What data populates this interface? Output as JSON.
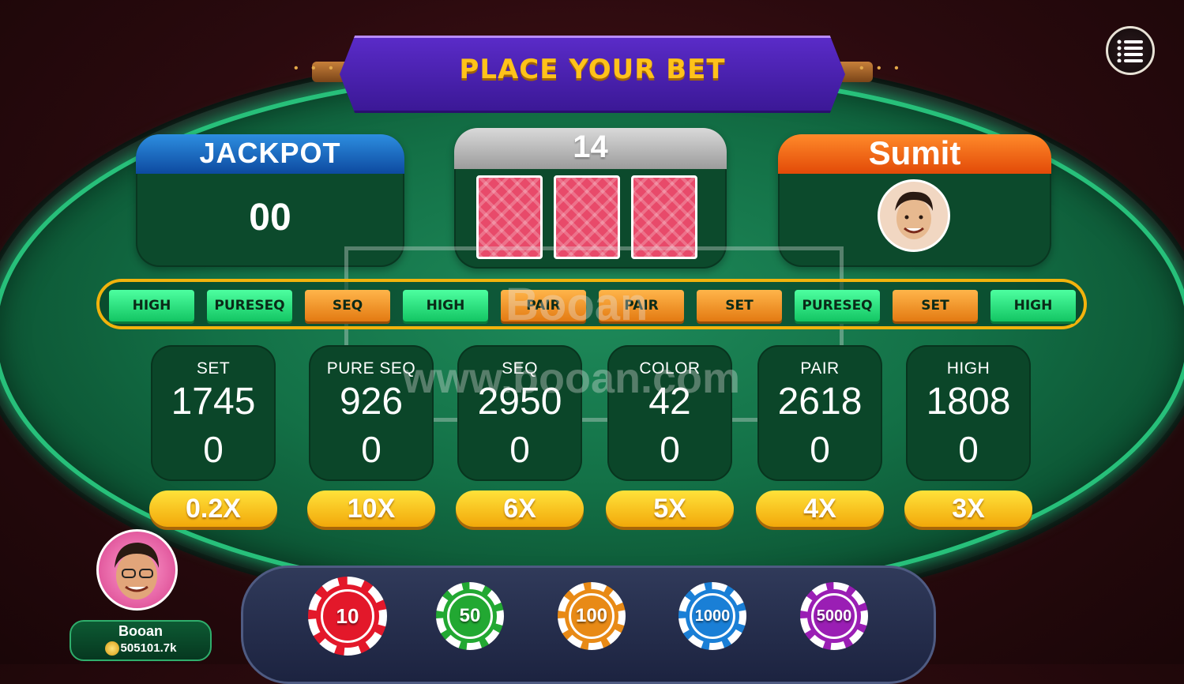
{
  "banner": {
    "title": "PLACE YOUR BET"
  },
  "menu": {
    "icon": "menu-icon"
  },
  "jackpot": {
    "label": "JACKPOT",
    "value": "00"
  },
  "round": {
    "timer": "14"
  },
  "player": {
    "name": "Sumit"
  },
  "history": [
    {
      "label": "HIGH",
      "color": "green"
    },
    {
      "label": "PURESEQ",
      "color": "green"
    },
    {
      "label": "SEQ",
      "color": "orange"
    },
    {
      "label": "HIGH",
      "color": "green"
    },
    {
      "label": "PAIR",
      "color": "orange"
    },
    {
      "label": "PAIR",
      "color": "orange"
    },
    {
      "label": "SET",
      "color": "orange"
    },
    {
      "label": "PURESEQ",
      "color": "green"
    },
    {
      "label": "SET",
      "color": "orange"
    },
    {
      "label": "HIGH",
      "color": "green"
    }
  ],
  "bets": [
    {
      "label": "SET",
      "total": "1745",
      "mine": "0",
      "multiplier": "0.2X"
    },
    {
      "label": "PURE SEQ",
      "total": "926",
      "mine": "0",
      "multiplier": "10X"
    },
    {
      "label": "SEQ",
      "total": "2950",
      "mine": "0",
      "multiplier": "6X"
    },
    {
      "label": "COLOR",
      "total": "42",
      "mine": "0",
      "multiplier": "5X"
    },
    {
      "label": "PAIR",
      "total": "2618",
      "mine": "0",
      "multiplier": "4X"
    },
    {
      "label": "HIGH",
      "total": "1808",
      "mine": "0",
      "multiplier": "3X"
    }
  ],
  "watermark": {
    "line1": "Booan",
    "line2": "www.booan.com"
  },
  "chips": [
    {
      "value": "10",
      "color": "#e3182a"
    },
    {
      "value": "50",
      "color": "#22a832"
    },
    {
      "value": "100",
      "color": "#e88a16"
    },
    {
      "value": "1000",
      "color": "#1a7fd6"
    },
    {
      "value": "5000",
      "color": "#9a1eb4"
    }
  ],
  "user": {
    "name": "Booan",
    "balance": "505101.7k"
  }
}
